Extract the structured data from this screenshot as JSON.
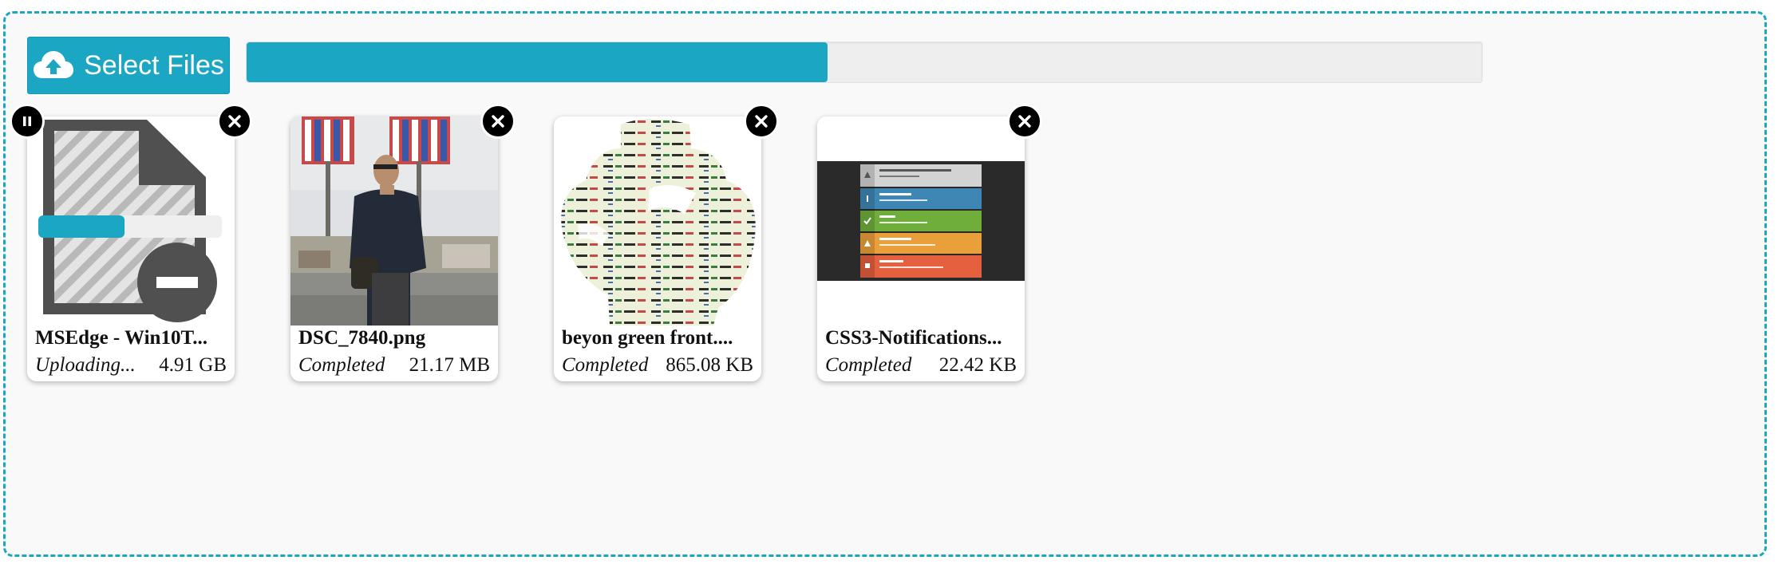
{
  "uploader": {
    "select_label": "Select Files",
    "select_icon": "cloud-upload-icon",
    "overall_progress": 0.47,
    "accent_color": "#1ba7c4"
  },
  "files": [
    {
      "name": "MSEdge - Win10T...",
      "status": "Uploading...",
      "size": "4.91 GB",
      "thumb": "generic-file-icon",
      "file_progress": 0.47
    },
    {
      "name": "DSC_7840.png",
      "status": "Completed",
      "size": "21.17 MB",
      "thumb": "photo-man-standing"
    },
    {
      "name": "beyon green front....",
      "status": "Completed",
      "size": "865.08 KB",
      "thumb": "text-fist-graphic"
    },
    {
      "name": "CSS3-Notifications...",
      "status": "Completed",
      "size": "22.42 KB",
      "thumb": "notification-bars-screenshot"
    }
  ]
}
